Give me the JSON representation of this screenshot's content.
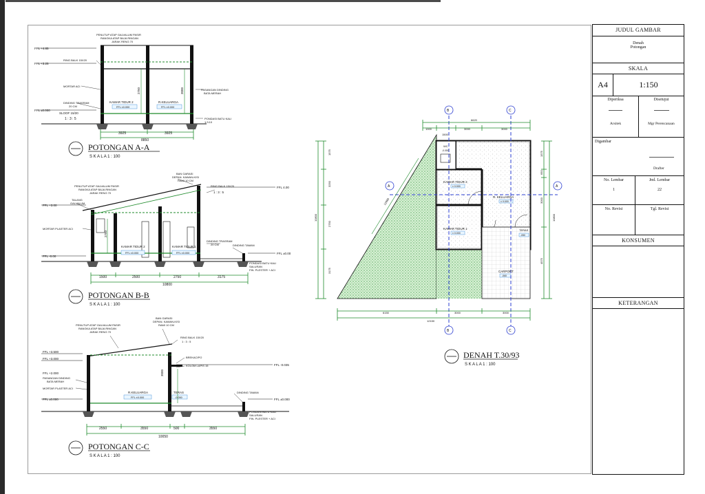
{
  "title_block": {
    "judul_gambar_label": "JUDUL GAMBAR",
    "judul_line1": "Denah",
    "judul_line2": "Potongan",
    "skala_label": "SKALA",
    "paper_size": "A4",
    "scale_value": "1:150",
    "diperiksa_label": "Diperiksa",
    "disetujui_label": "Disetujui",
    "arsitek_label": "Arsitek",
    "mgr_label": "Mgr Perencanaan",
    "digambar_label": "Digambar",
    "drafter_label": "Drafter",
    "no_lembar_label": "No. Lembar",
    "no_lembar_value": "1",
    "jml_lembar_label": "Jml. Lembar",
    "jml_lembar_value": "22",
    "no_revisi_label": "No. Revisi",
    "tgl_revisi_label": "Tgl. Revisi",
    "konsumen_label": "KONSUMEN",
    "keterangan_label": "KETERANGAN"
  },
  "section_aa": {
    "title": "POTONGAN A-A",
    "scale": "S K A L A     1 : 100",
    "room1": "KAMAR TIDUR 2",
    "room1_ffl": "FFL ±0.000",
    "room2": "R.KELUARGA",
    "room2_ffl": "FFL ±0.000",
    "dims": [
      "3925",
      "3925"
    ],
    "total": "8850",
    "lv1": "FFL +4.85",
    "lv2": "FFL +3.25",
    "lv3": "FFL ±0.000",
    "roof_note": "PENUTUP ATAP GALVALUM PASIR",
    "roof_note2": "RANGKA ATAP BAJA RINGAN",
    "roof_note3": "JARAK RENG 70",
    "ring": "RING BALK 15X20",
    "mortar": "MORTAR ACI",
    "dinding": "DINDING TRASRAM",
    "dinding2": "20 CM",
    "sloof": "SLOOF 15/20",
    "sloof2": "1 : 3 : 5",
    "pasangan": "PASANGAN DINDING",
    "pasangan2": "BATA MERAH",
    "pondasi": "PONDASI BATU KALI",
    "pondasi2": "1:3:10",
    "h1": "2750",
    "h2": "3000"
  },
  "section_bb": {
    "title": "POTONGAN B-B",
    "scale": "S K A L A     1 : 100",
    "room1": "KAMAR TIDUR 2",
    "room1_ffl": "FFL ±0.000",
    "room2": "KAMAR TIDUR 1",
    "room2_ffl": "FFL ±0.000",
    "dims": [
      "1500",
      "2500",
      "2750",
      "3175"
    ],
    "total": "10800",
    "lv1": "FFL 4.00",
    "lv2": "FFL +3.00",
    "lv3": "FFL ±0.00",
    "lv4": "FFL -0.00",
    "h1": "2750",
    "balok": "BAN GARASI",
    "balok2": "DEPAN. KAWAN-KISI",
    "balok3": "RAMI 10 CM",
    "roof_note": "PENUTUP ATAP GALVALUM PASIR",
    "roof_note2": "RANGKA ATAP BAJA RINGAN",
    "roof_note3": "JARAK RENG 70",
    "talang": "TALANG",
    "talang2": "GALVALUM",
    "mortar": "MORTAR PLASTER ACI",
    "ring": "RING BALK 15X20",
    "ring2": "1 : 3 : 5",
    "dinding": "DINDING TRASRAM",
    "dinding2": "20 CM",
    "dinding_taman": "DINDING TAMAN",
    "pondasi": "PONDASI BATU KALI",
    "pondasi2": "SALURAN",
    "pondasi3": "FIN. PLESTER + ACI"
  },
  "section_cc": {
    "title": "POTONGAN C-C",
    "scale": "S K A L A     1 : 100",
    "room1": "R.KELUARGA",
    "room1_ffl": "FFL ±0.000",
    "room2": "TERAS",
    "room2_ffl": "-0.050",
    "dims": [
      "2550",
      "3550",
      "500",
      "3550"
    ],
    "total": "10050",
    "lv1": "FFL +3.500",
    "lv2": "FFL +3.000",
    "lv3": "FFL +2.000",
    "lv4": "FFL ±0.000",
    "lv5": "FFL -0.035",
    "lv6": "FFL ±0.000",
    "balok": "BAN GARASI",
    "balok2": "DEPAN. KAWAN-KISI",
    "balok3": "RAMI 10 CM",
    "roof_note": "PENUTUP ATAP GALVALUM PASIR",
    "roof_note2": "RANGKA ATAP BAJA RINGAN",
    "roof_note3": "JARAK RENG 70",
    "ring": "RING BALK 15X20",
    "ring2": "1 : 3 : 5",
    "kanopi": "BREKACIPO",
    "kolom": "KOLOM LAPIS 15",
    "pasangan": "PASANGAN DINDING",
    "pasangan2": "BATA MERAH",
    "mortar": "MORTAR PLASTER ACI",
    "dinding_taman": "DINDING TAMAN",
    "pondasi": "PONDASI BATU KALI",
    "pondasi2": "SALURAN",
    "pondasi3": "FIN. PLESTER + ACI",
    "h1": "3000"
  },
  "plan": {
    "title": "DENAH T.30/93",
    "scale": "S K A L A     1 : 100",
    "marker_a": "A",
    "marker_b": "B",
    "marker_c": "C",
    "kt2": "KAMAR TIDUR 2",
    "kt2_ffl": "± 0.000",
    "kt1": "KAMAR TIDUR 1",
    "kt1_ffl": "± 0.000",
    "rk": "R. KELUARGA",
    "rk_ffl": "± 0.000",
    "km": "WC",
    "km_ffl": "-0.050",
    "teras": "TERAS",
    "teras_ffl": "-050",
    "carport": "CARPORT",
    "carport_ffl": "-060",
    "top_dims": [
      "1000",
      "1500",
      "3000",
      "3000"
    ],
    "top_total": "6620",
    "bottom_dims": [
      "6150",
      "3000",
      "3000"
    ],
    "bottom_total": "12150",
    "left_dims": [
      "1575",
      "3250",
      "2750",
      "3175"
    ],
    "left_total": "10800",
    "right_dims": [
      "1575",
      "650",
      "3000",
      "4575"
    ],
    "right_total": "10800",
    "diag": "12660"
  }
}
